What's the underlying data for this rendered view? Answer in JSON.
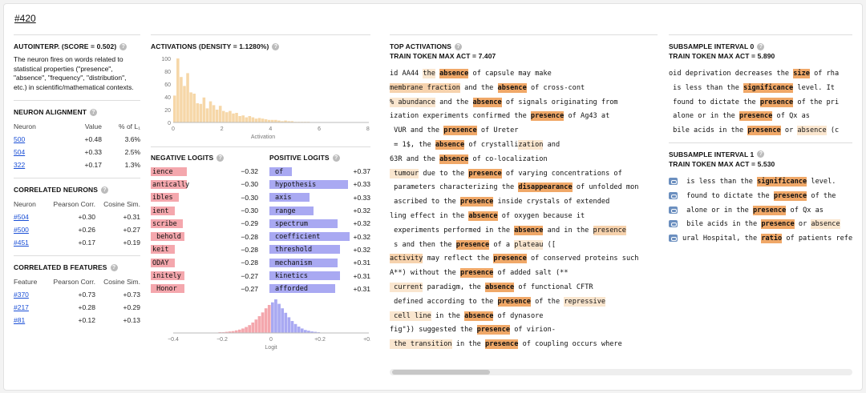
{
  "feature_id": "#420",
  "autointerp": {
    "title": "AUTOINTERP. (SCORE = 0.502)",
    "description": "The neuron fires on words related to statistical properties (\"presence\", \"absence\", \"frequency\", \"distribution\", etc.) in scientific/mathematical contexts."
  },
  "neuron_alignment": {
    "title": "NEURON ALIGNMENT",
    "headers": [
      "Neuron",
      "Value",
      "% of L₁"
    ],
    "rows": [
      {
        "neuron": "500",
        "value": "+0.48",
        "pct": "3.6%"
      },
      {
        "neuron": "504",
        "value": "+0.33",
        "pct": "2.5%"
      },
      {
        "neuron": "322",
        "value": "+0.17",
        "pct": "1.3%"
      }
    ]
  },
  "correlated_neurons": {
    "title": "CORRELATED NEURONS",
    "headers": [
      "Neuron",
      "Pearson Corr.",
      "Cosine Sim."
    ],
    "rows": [
      {
        "id": "#504",
        "pearson": "+0.30",
        "cosine": "+0.31"
      },
      {
        "id": "#500",
        "pearson": "+0.26",
        "cosine": "+0.27"
      },
      {
        "id": "#451",
        "pearson": "+0.17",
        "cosine": "+0.19"
      }
    ]
  },
  "correlated_b": {
    "title": "CORRELATED B FEATURES",
    "headers": [
      "Feature",
      "Pearson Corr.",
      "Cosine Sim."
    ],
    "rows": [
      {
        "id": "#370",
        "pearson": "+0.73",
        "cosine": "+0.73"
      },
      {
        "id": "#217",
        "pearson": "+0.28",
        "cosine": "+0.29"
      },
      {
        "id": "#81",
        "pearson": "+0.12",
        "cosine": "+0.13"
      }
    ]
  },
  "activations": {
    "title": "ACTIVATIONS (DENSITY = 1.1280%)",
    "xlabel": "Activation",
    "x_ticks": [
      "0",
      "2",
      "4",
      "6",
      "8"
    ],
    "y_ticks": [
      "100",
      "80",
      "60",
      "40",
      "20",
      "0"
    ],
    "bars": [
      42,
      100,
      71,
      57,
      77,
      47,
      45,
      30,
      29,
      39,
      22,
      33,
      27,
      20,
      26,
      18,
      16,
      18,
      14,
      15,
      10,
      11,
      8,
      10,
      8,
      6,
      7,
      6,
      5,
      4,
      4,
      4,
      3,
      2,
      3,
      2,
      2,
      1,
      1,
      1,
      1,
      1,
      0.5,
      0.5,
      0.5,
      0.4
    ]
  },
  "negative_logits": {
    "title": "NEGATIVE LOGITS",
    "rows": [
      {
        "token": "ience",
        "value": "−0.32"
      },
      {
        "token": "antically",
        "value": "−0.30"
      },
      {
        "token": "ibles",
        "value": "−0.30"
      },
      {
        "token": "ient",
        "value": "−0.30"
      },
      {
        "token": "scribe",
        "value": "−0.29"
      },
      {
        "token": " behold",
        "value": "−0.28"
      },
      {
        "token": "keit",
        "value": "−0.28"
      },
      {
        "token": "ODAY",
        "value": "−0.28"
      },
      {
        "token": "initely",
        "value": "−0.27"
      },
      {
        "token": " Honor",
        "value": "−0.27"
      }
    ],
    "bar_fill": [
      0.45,
      0.45,
      0.35,
      0.3,
      0.4,
      0.42,
      0.3,
      0.3,
      0.42,
      0.42
    ]
  },
  "positive_logits": {
    "title": "POSITIVE LOGITS",
    "rows": [
      {
        "token": " of",
        "value": "+0.37"
      },
      {
        "token": " hypothesis",
        "value": "+0.33"
      },
      {
        "token": " axis",
        "value": "+0.33"
      },
      {
        "token": " range",
        "value": "+0.32"
      },
      {
        "token": " spectrum",
        "value": "+0.32"
      },
      {
        "token": " coefficient",
        "value": "+0.32"
      },
      {
        "token": " threshold",
        "value": "+0.32"
      },
      {
        "token": " mechanism",
        "value": "+0.31"
      },
      {
        "token": " kinetics",
        "value": "+0.31"
      },
      {
        "token": " afforded",
        "value": "+0.31"
      }
    ],
    "bar_fill": [
      0.28,
      0.98,
      0.5,
      0.55,
      0.85,
      1.0,
      0.88,
      0.85,
      0.88,
      0.82
    ]
  },
  "logit_hist": {
    "xlabel": "Logit",
    "x_ticks": [
      "−0.4",
      "−0.2",
      "0",
      "+0.2",
      "+0.4"
    ],
    "neg_bars": [
      1,
      1,
      1,
      2,
      2,
      3,
      4,
      5,
      7,
      9,
      12,
      16,
      21,
      28,
      36,
      45,
      55,
      66,
      75
    ],
    "pos_bars": [
      82,
      90,
      78,
      66,
      54,
      42,
      32,
      24,
      17,
      12,
      8,
      6,
      4,
      3,
      2,
      1,
      1,
      1,
      1
    ]
  },
  "top_activations": {
    "title": "TOP ACTIVATIONS",
    "subtitle": "TRAIN TOKEN MAX ACT = 7.407",
    "examples": [
      [
        [
          "id AA44 ",
          ""
        ],
        [
          "the",
          "hi3"
        ],
        [
          " ",
          ""
        ],
        [
          "absence",
          "hi"
        ],
        [
          " of capsule may make",
          ""
        ]
      ],
      [
        [
          "membrane fraction",
          "hi2"
        ],
        [
          " and the ",
          ""
        ],
        [
          "absence",
          "hi"
        ],
        [
          " of cross-cont",
          ""
        ]
      ],
      [
        [
          "% abundance",
          "hi3"
        ],
        [
          " and the ",
          ""
        ],
        [
          "absence",
          "hi"
        ],
        [
          " of signals originating from",
          ""
        ]
      ],
      [
        [
          "ization experiments confirmed the ",
          ""
        ],
        [
          "presence",
          "hi"
        ],
        [
          " of Ag43 at",
          ""
        ]
      ],
      [
        [
          " VUR and the ",
          ""
        ],
        [
          "presence",
          "hi"
        ],
        [
          " of Ureter",
          ""
        ]
      ],
      [
        [
          " = 1$, the ",
          ""
        ],
        [
          "absence",
          "hi"
        ],
        [
          " of crystalli",
          ""
        ],
        [
          "zation",
          "hi3"
        ],
        [
          " and",
          ""
        ]
      ],
      [
        [
          "63R and the ",
          ""
        ],
        [
          "absence",
          "hi"
        ],
        [
          " of co-localization",
          ""
        ]
      ],
      [
        [
          " tumour",
          "hi3"
        ],
        [
          " due to the ",
          ""
        ],
        [
          "presence",
          "hi"
        ],
        [
          " of varying concentrations of",
          ""
        ]
      ],
      [
        [
          " parameters characterizing the ",
          ""
        ],
        [
          "disappearance",
          "hi"
        ],
        [
          " of unfolded mon",
          ""
        ]
      ],
      [
        [
          " ascribed to the ",
          ""
        ],
        [
          "presence",
          "hi"
        ],
        [
          " inside crystals of extended",
          ""
        ]
      ],
      [
        [
          "ling effect in the ",
          ""
        ],
        [
          "absence",
          "hi"
        ],
        [
          " of oxygen because it",
          ""
        ]
      ],
      [
        [
          " experiments performed in the ",
          ""
        ],
        [
          "absence",
          "hi"
        ],
        [
          " and in the ",
          ""
        ],
        [
          "presence",
          "hi2"
        ]
      ],
      [
        [
          " s and then the ",
          ""
        ],
        [
          "presence",
          "hi"
        ],
        [
          " of a ",
          ""
        ],
        [
          "plateau",
          "hi3"
        ],
        [
          " ([",
          ""
        ]
      ],
      [
        [
          "activity",
          "hi2"
        ],
        [
          " may reflect the ",
          ""
        ],
        [
          "presence",
          "hi"
        ],
        [
          " of conserved proteins such",
          ""
        ]
      ],
      [
        [
          "A**) without the ",
          ""
        ],
        [
          "presence",
          "hi"
        ],
        [
          " of added salt (**",
          ""
        ]
      ],
      [
        [
          " current",
          "hi3"
        ],
        [
          " paradigm, the ",
          ""
        ],
        [
          "absence",
          "hi"
        ],
        [
          " of functional CFTR",
          ""
        ]
      ],
      [
        [
          " defined according to the ",
          ""
        ],
        [
          "presence",
          "hi"
        ],
        [
          " of the ",
          ""
        ],
        [
          "repressive",
          "hi3"
        ]
      ],
      [
        [
          " cell line",
          "hi3"
        ],
        [
          " in the ",
          ""
        ],
        [
          "absence",
          "hi"
        ],
        [
          " of dynasore",
          ""
        ]
      ],
      [
        [
          "fig\"}) suggested the ",
          ""
        ],
        [
          "presence",
          "hi"
        ],
        [
          " of virion-",
          ""
        ]
      ],
      [
        [
          " the transition",
          "hi3"
        ],
        [
          " in the ",
          ""
        ],
        [
          "presence",
          "hi"
        ],
        [
          " of coupling occurs where",
          ""
        ]
      ]
    ]
  },
  "subsample0": {
    "title": "SUBSAMPLE INTERVAL 0",
    "subtitle": "TRAIN TOKEN MAX ACT = 5.890",
    "examples": [
      [
        [
          "oid deprivation decreases the ",
          ""
        ],
        [
          "size",
          "hi"
        ],
        [
          " of rha",
          ""
        ]
      ],
      [
        [
          " is less than the ",
          ""
        ],
        [
          "significance",
          "hi"
        ],
        [
          " level. It",
          ""
        ]
      ],
      [
        [
          " found to dictate the ",
          ""
        ],
        [
          "presence",
          "hi"
        ],
        [
          " of the pri",
          ""
        ]
      ],
      [
        [
          " alone or in the ",
          ""
        ],
        [
          "presence",
          "hi"
        ],
        [
          " of Qx as",
          ""
        ]
      ],
      [
        [
          " bile acids in the ",
          ""
        ],
        [
          "presence",
          "hi"
        ],
        [
          " or ",
          ""
        ],
        [
          "absence",
          "hi3"
        ],
        [
          " (c",
          ""
        ]
      ]
    ]
  },
  "subsample1": {
    "title": "SUBSAMPLE INTERVAL 1",
    "subtitle": "TRAIN TOKEN MAX ACT = 5.530",
    "examples": [
      [
        [
          " is less than the ",
          ""
        ],
        [
          "significance",
          "hi"
        ],
        [
          " level.",
          ""
        ]
      ],
      [
        [
          " found to dictate the ",
          ""
        ],
        [
          "presence",
          "hi"
        ],
        [
          " of the",
          ""
        ]
      ],
      [
        [
          " alone or in the ",
          ""
        ],
        [
          "presence",
          "hi"
        ],
        [
          " of Qx as",
          ""
        ]
      ],
      [
        [
          " bile acids in the ",
          ""
        ],
        [
          "presence",
          "hi"
        ],
        [
          " or ",
          ""
        ],
        [
          "absence",
          "hi3"
        ]
      ],
      [
        [
          "ural Hospital, the ",
          ""
        ],
        [
          "ratio",
          "hi"
        ],
        [
          " of patients refe",
          ""
        ]
      ]
    ]
  },
  "colors": {
    "act_bar": "#f6d7a8",
    "neg": "#f4a7ad",
    "pos": "#a9a9f2"
  }
}
